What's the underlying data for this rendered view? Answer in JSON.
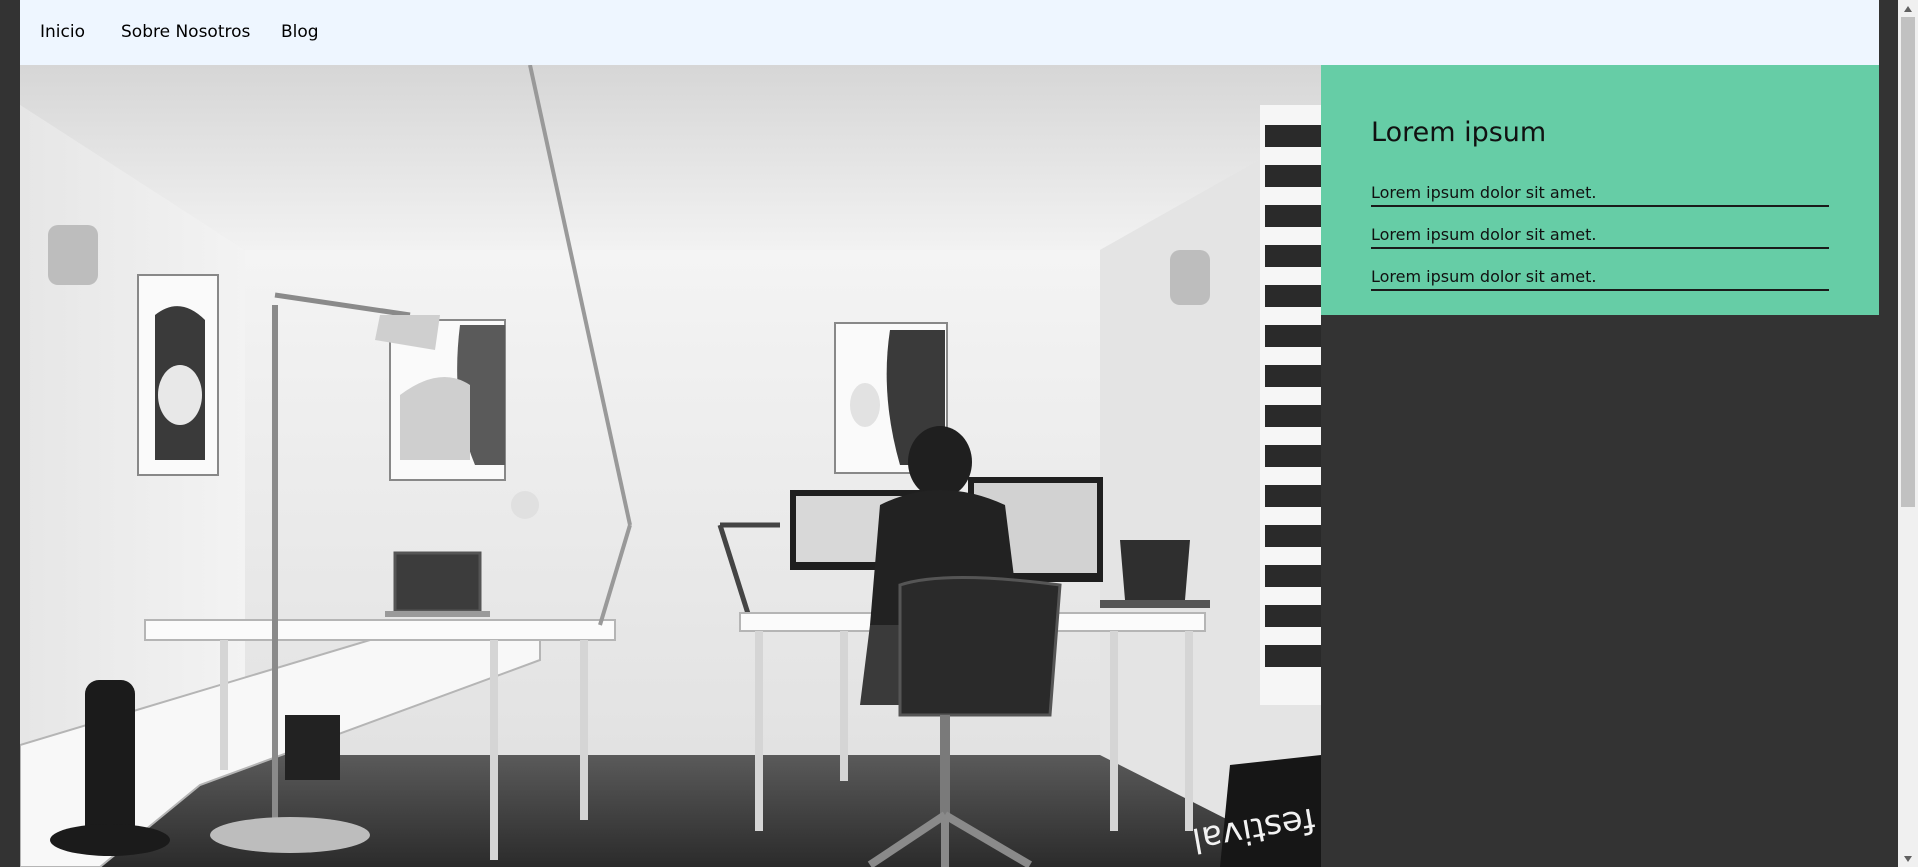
{
  "nav": {
    "items": [
      {
        "label": "Inicio"
      },
      {
        "label": "Sobre Nosotros"
      },
      {
        "label": "Blog"
      }
    ]
  },
  "hero": {
    "image_icon": "office-photo",
    "poster_text": "festival"
  },
  "sidebar": {
    "title": "Lorem ipsum",
    "items": [
      {
        "label": "Lorem ipsum dolor sit amet."
      },
      {
        "label": "Lorem ipsum dolor sit amet."
      },
      {
        "label": "Lorem ipsum dolor sit amet."
      }
    ]
  },
  "colors": {
    "nav_bg": "#eef6ff",
    "page_bg": "#333333",
    "sidebar_bg": "#66cda6"
  }
}
